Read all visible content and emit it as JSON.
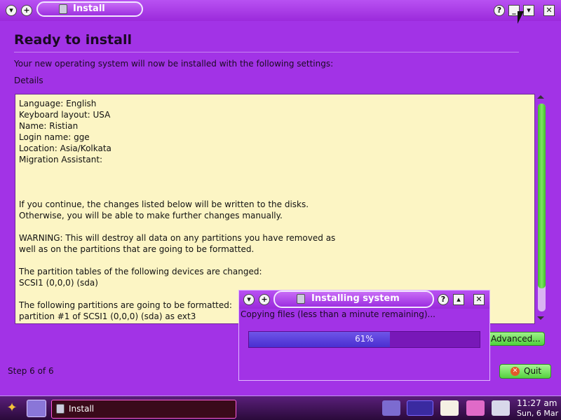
{
  "window": {
    "title": "Install",
    "page_title": "Ready to install",
    "intro": "Your new operating system will now be installed with the following settings:",
    "details_label": "Details",
    "details_lines": [
      "Language: English",
      "Keyboard layout: USA",
      "Name: Ristian",
      "Login name: gge",
      "Location: Asia/Kolkata",
      "Migration Assistant:",
      "",
      "",
      "",
      "If you continue, the changes listed below will be written to the disks.",
      "Otherwise, you will be able to make further changes manually.",
      "",
      "WARNING: This will destroy all data on any partitions you have removed as",
      "well as on the partitions that are going to be formatted.",
      "",
      "The partition tables of the following devices are changed:",
      "SCSI1 (0,0,0) (sda)",
      "",
      "The following partitions are going to be formatted:",
      "partition #1 of SCSI1 (0,0,0) (sda) as ext3"
    ],
    "advanced_label": "Advanced...",
    "step_label": "Step 6 of 6",
    "quit_label": "Quit"
  },
  "dialog": {
    "title": "Installing system",
    "status": "Copying files (less than a minute remaining)...",
    "progress_percent": 61,
    "progress_text": "61%"
  },
  "taskbar": {
    "task_label": "Install",
    "clock_time": "11:27 am",
    "clock_date": "Sun, 6 Mar"
  },
  "colors": {
    "window_bg": "#a233e6",
    "details_bg": "#fcf5c4",
    "button_green": "#55d240",
    "progress_fill": "#4a2fd0"
  }
}
